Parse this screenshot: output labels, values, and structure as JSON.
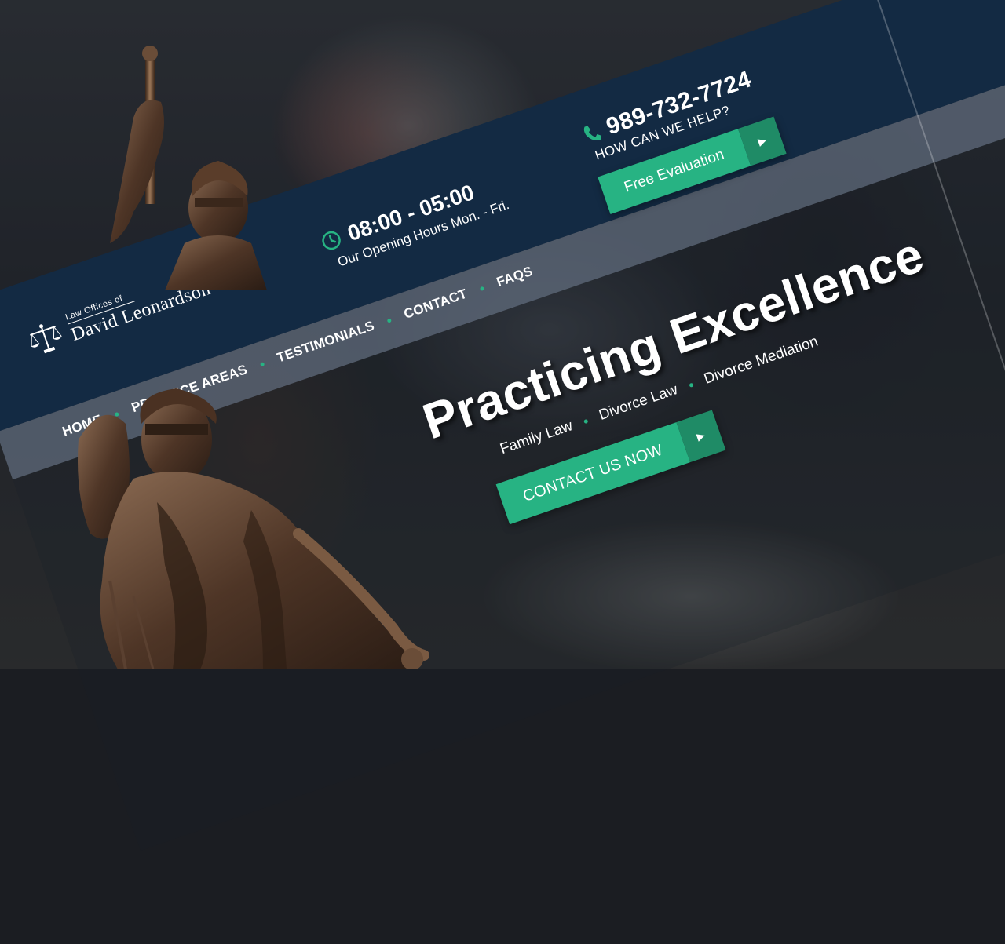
{
  "header": {
    "logo_small": "Law Offices of",
    "logo_name": "David Leonardson",
    "hours_time": "08:00 - 05:00",
    "hours_label": "Our Opening Hours Mon. - Fri.",
    "phone": "989-732-7724",
    "phone_label": "HOW CAN WE HELP?",
    "cta_label": "Free Evaluation"
  },
  "nav": {
    "items": [
      "HOME",
      "PRACTICE AREAS",
      "TESTIMONIALS",
      "CONTACT",
      "FAQS"
    ]
  },
  "hero": {
    "title": "Practicing Excellence",
    "tags": [
      "Family Law",
      "Divorce Law",
      "Divorce Mediation"
    ],
    "cta_label": "CONTACT US NOW"
  },
  "colors": {
    "header_bg": "#132a43",
    "accent_green": "#27b383",
    "accent_green_dark": "#1f8b66"
  },
  "icons": {
    "clock": "clock-icon",
    "phone": "phone-icon",
    "scales": "scales-of-justice-icon",
    "arrow": "play-arrow-icon"
  }
}
